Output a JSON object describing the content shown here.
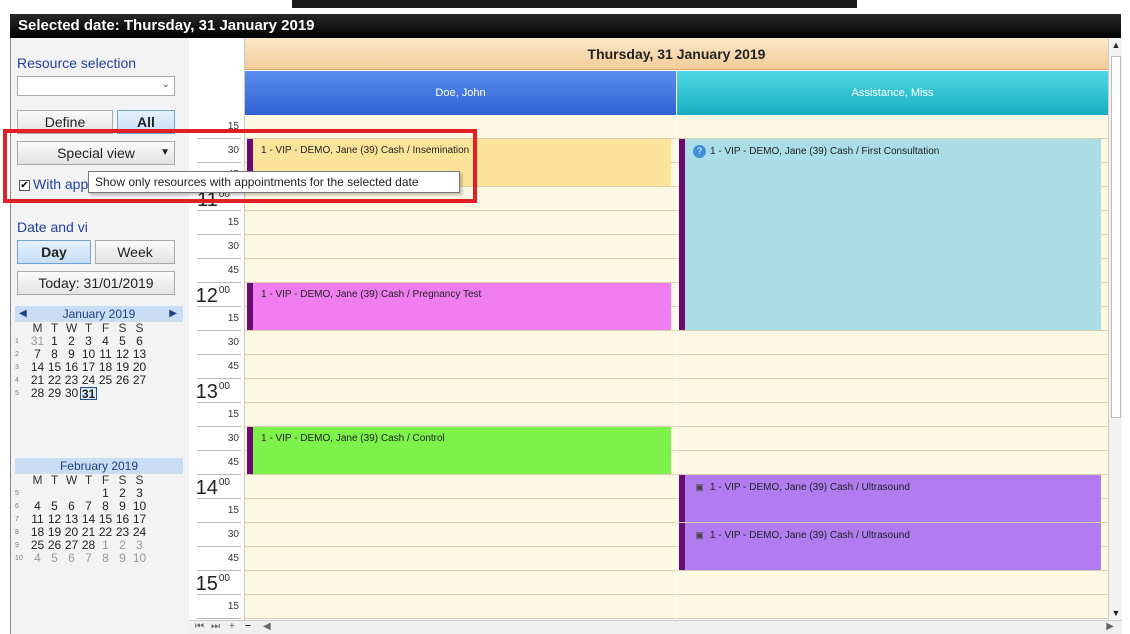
{
  "titlebar": {
    "text": "Selected date: Thursday, 31 January 2019"
  },
  "sidebar": {
    "resource_label": "Resource selection",
    "define": "Define",
    "all": "All",
    "special_view": "Special view",
    "with_appointments": "With appointments",
    "date_view_label": "Date and vi",
    "day": "Day",
    "week": "Week",
    "today": "Today: 31/01/2019"
  },
  "tooltip": "Show only resources with appointments for the selected date",
  "cal1": {
    "title": "January 2019",
    "dow": [
      "M",
      "T",
      "W",
      "T",
      "F",
      "S",
      "S"
    ],
    "weeks": [
      {
        "wn": "1",
        "days": [
          "31",
          "1",
          "2",
          "3",
          "4",
          "5",
          "6"
        ]
      },
      {
        "wn": "2",
        "days": [
          "7",
          "8",
          "9",
          "10",
          "11",
          "12",
          "13"
        ]
      },
      {
        "wn": "3",
        "days": [
          "14",
          "15",
          "16",
          "17",
          "18",
          "19",
          "20"
        ]
      },
      {
        "wn": "4",
        "days": [
          "21",
          "22",
          "23",
          "24",
          "25",
          "26",
          "27"
        ]
      },
      {
        "wn": "5",
        "days": [
          "28",
          "29",
          "30",
          "31",
          "",
          "",
          ""
        ]
      }
    ]
  },
  "cal2": {
    "title": "February 2019",
    "dow": [
      "M",
      "T",
      "W",
      "T",
      "F",
      "S",
      "S"
    ],
    "weeks": [
      {
        "wn": "5",
        "days": [
          "",
          "",
          "",
          "",
          "1",
          "2",
          "3"
        ]
      },
      {
        "wn": "6",
        "days": [
          "4",
          "5",
          "6",
          "7",
          "8",
          "9",
          "10"
        ]
      },
      {
        "wn": "7",
        "days": [
          "11",
          "12",
          "13",
          "14",
          "15",
          "16",
          "17"
        ]
      },
      {
        "wn": "8",
        "days": [
          "18",
          "19",
          "20",
          "21",
          "22",
          "23",
          "24"
        ]
      },
      {
        "wn": "9",
        "days": [
          "25",
          "26",
          "27",
          "28",
          "1",
          "2",
          "3"
        ]
      },
      {
        "wn": "10",
        "days": [
          "4",
          "5",
          "6",
          "7",
          "8",
          "9",
          "10"
        ]
      }
    ]
  },
  "timeline": [
    {
      "label": "15"
    },
    {
      "label": "30"
    },
    {
      "label": "45"
    },
    {
      "hour": "11",
      "label": "00"
    },
    {
      "label": "15"
    },
    {
      "label": "30"
    },
    {
      "label": "45"
    },
    {
      "hour": "12",
      "label": "00"
    },
    {
      "label": "15"
    },
    {
      "label": "30"
    },
    {
      "label": "45"
    },
    {
      "hour": "13",
      "label": "00"
    },
    {
      "label": "15"
    },
    {
      "label": "30"
    },
    {
      "label": "45"
    },
    {
      "hour": "14",
      "label": "00"
    },
    {
      "label": "15"
    },
    {
      "label": "30"
    },
    {
      "label": "45"
    },
    {
      "hour": "15",
      "label": "00"
    },
    {
      "label": "15"
    }
  ],
  "day_header": "Thursday, 31 January 2019",
  "resources": [
    {
      "name": "Doe, John",
      "color": "#3f74e0"
    },
    {
      "name": "Assistance, Miss",
      "color": "#2cc3d1"
    }
  ],
  "appointments": [
    {
      "col": 0,
      "start": 1,
      "span": 2,
      "text": "1 - VIP - DEMO, Jane (39) Cash / Insemination",
      "color": "#fbe49a",
      "icon": ""
    },
    {
      "col": 0,
      "start": 7,
      "span": 2,
      "text": "1 - VIP - DEMO, Jane (39) Cash / Pregnancy Test",
      "color": "#ef7df0",
      "icon": ""
    },
    {
      "col": 0,
      "start": 13,
      "span": 2,
      "text": "1 - VIP - DEMO, Jane (39) Cash / Control",
      "color": "#7cf24a",
      "icon": ""
    },
    {
      "col": 1,
      "start": 1,
      "span": 8,
      "text": "1 - VIP - DEMO, Jane (39) Cash / First Consultation",
      "color": "#abdde6",
      "icon": "?"
    },
    {
      "col": 1,
      "start": 15,
      "span": 2,
      "text": "1 - VIP - DEMO, Jane (39) Cash / Ultrasound",
      "color": "#b07cf0",
      "icon": "binoculars"
    },
    {
      "col": 1,
      "start": 17,
      "span": 2,
      "text": "1 - VIP - DEMO, Jane (39) Cash / Ultrasound",
      "color": "#b07cf0",
      "icon": "binoculars"
    }
  ]
}
